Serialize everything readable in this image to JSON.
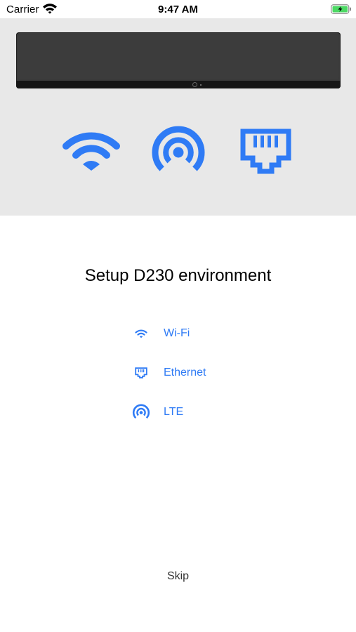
{
  "status_bar": {
    "carrier": "Carrier",
    "time": "9:47 AM"
  },
  "title": "Setup D230 environment",
  "options": [
    {
      "label": "Wi-Fi",
      "icon": "wifi-icon"
    },
    {
      "label": "Ethernet",
      "icon": "ethernet-icon"
    },
    {
      "label": "LTE",
      "icon": "lte-icon"
    }
  ],
  "skip_label": "Skip",
  "colors": {
    "accent": "#2f7bf5",
    "hero_background": "#e8e8e8",
    "device": "#3a3a3a",
    "battery": "#4cd964"
  }
}
